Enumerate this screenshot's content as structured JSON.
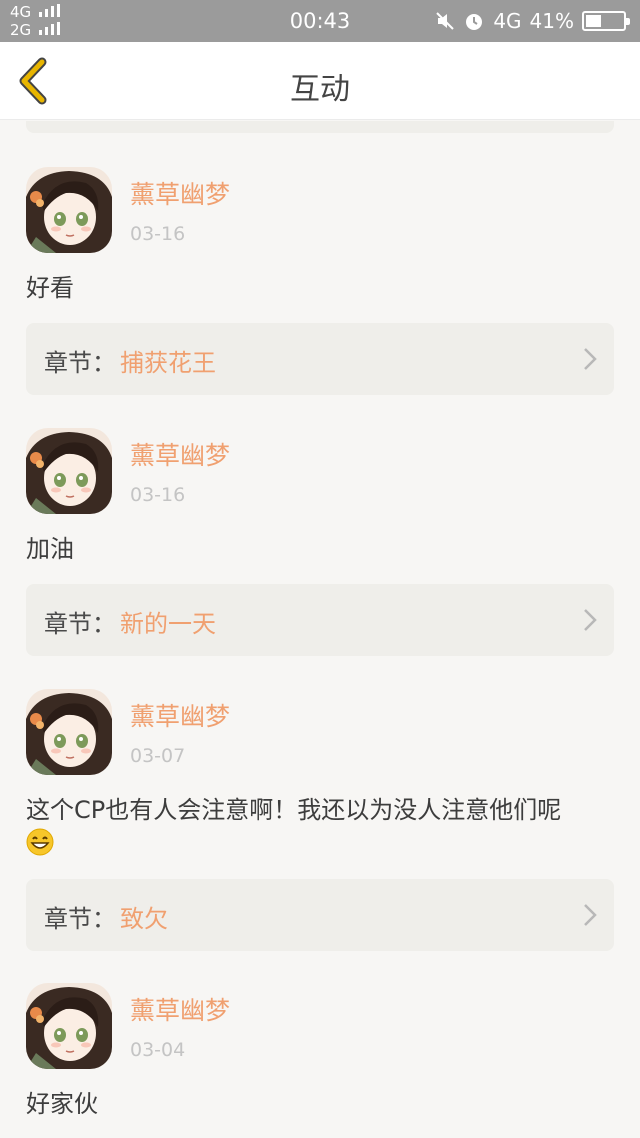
{
  "status_bar": {
    "signal_1": "4G",
    "signal_2": "2G",
    "time": "00:43",
    "network": "4G",
    "battery_percent": "41%",
    "battery_level": 0.41
  },
  "header": {
    "title": "互动"
  },
  "comments": [
    {
      "user": "薰草幽梦",
      "date": "03-16",
      "text": "好看",
      "chapter_label": "章节：",
      "chapter_name": "捕获花王"
    },
    {
      "user": "薰草幽梦",
      "date": "03-16",
      "text": "加油",
      "chapter_label": "章节：",
      "chapter_name": "新的一天"
    },
    {
      "user": "薰草幽梦",
      "date": "03-07",
      "text": "这个CP也有人会注意啊！我还以为没人注意他们呢",
      "emoji": "grinning-face-emoji",
      "chapter_label": "章节：",
      "chapter_name": "致欠"
    },
    {
      "user": "薰草幽梦",
      "date": "03-04",
      "text": "好家伙"
    }
  ],
  "colors": {
    "accent": "#f0a070",
    "back_arrow": "#e8b500"
  }
}
